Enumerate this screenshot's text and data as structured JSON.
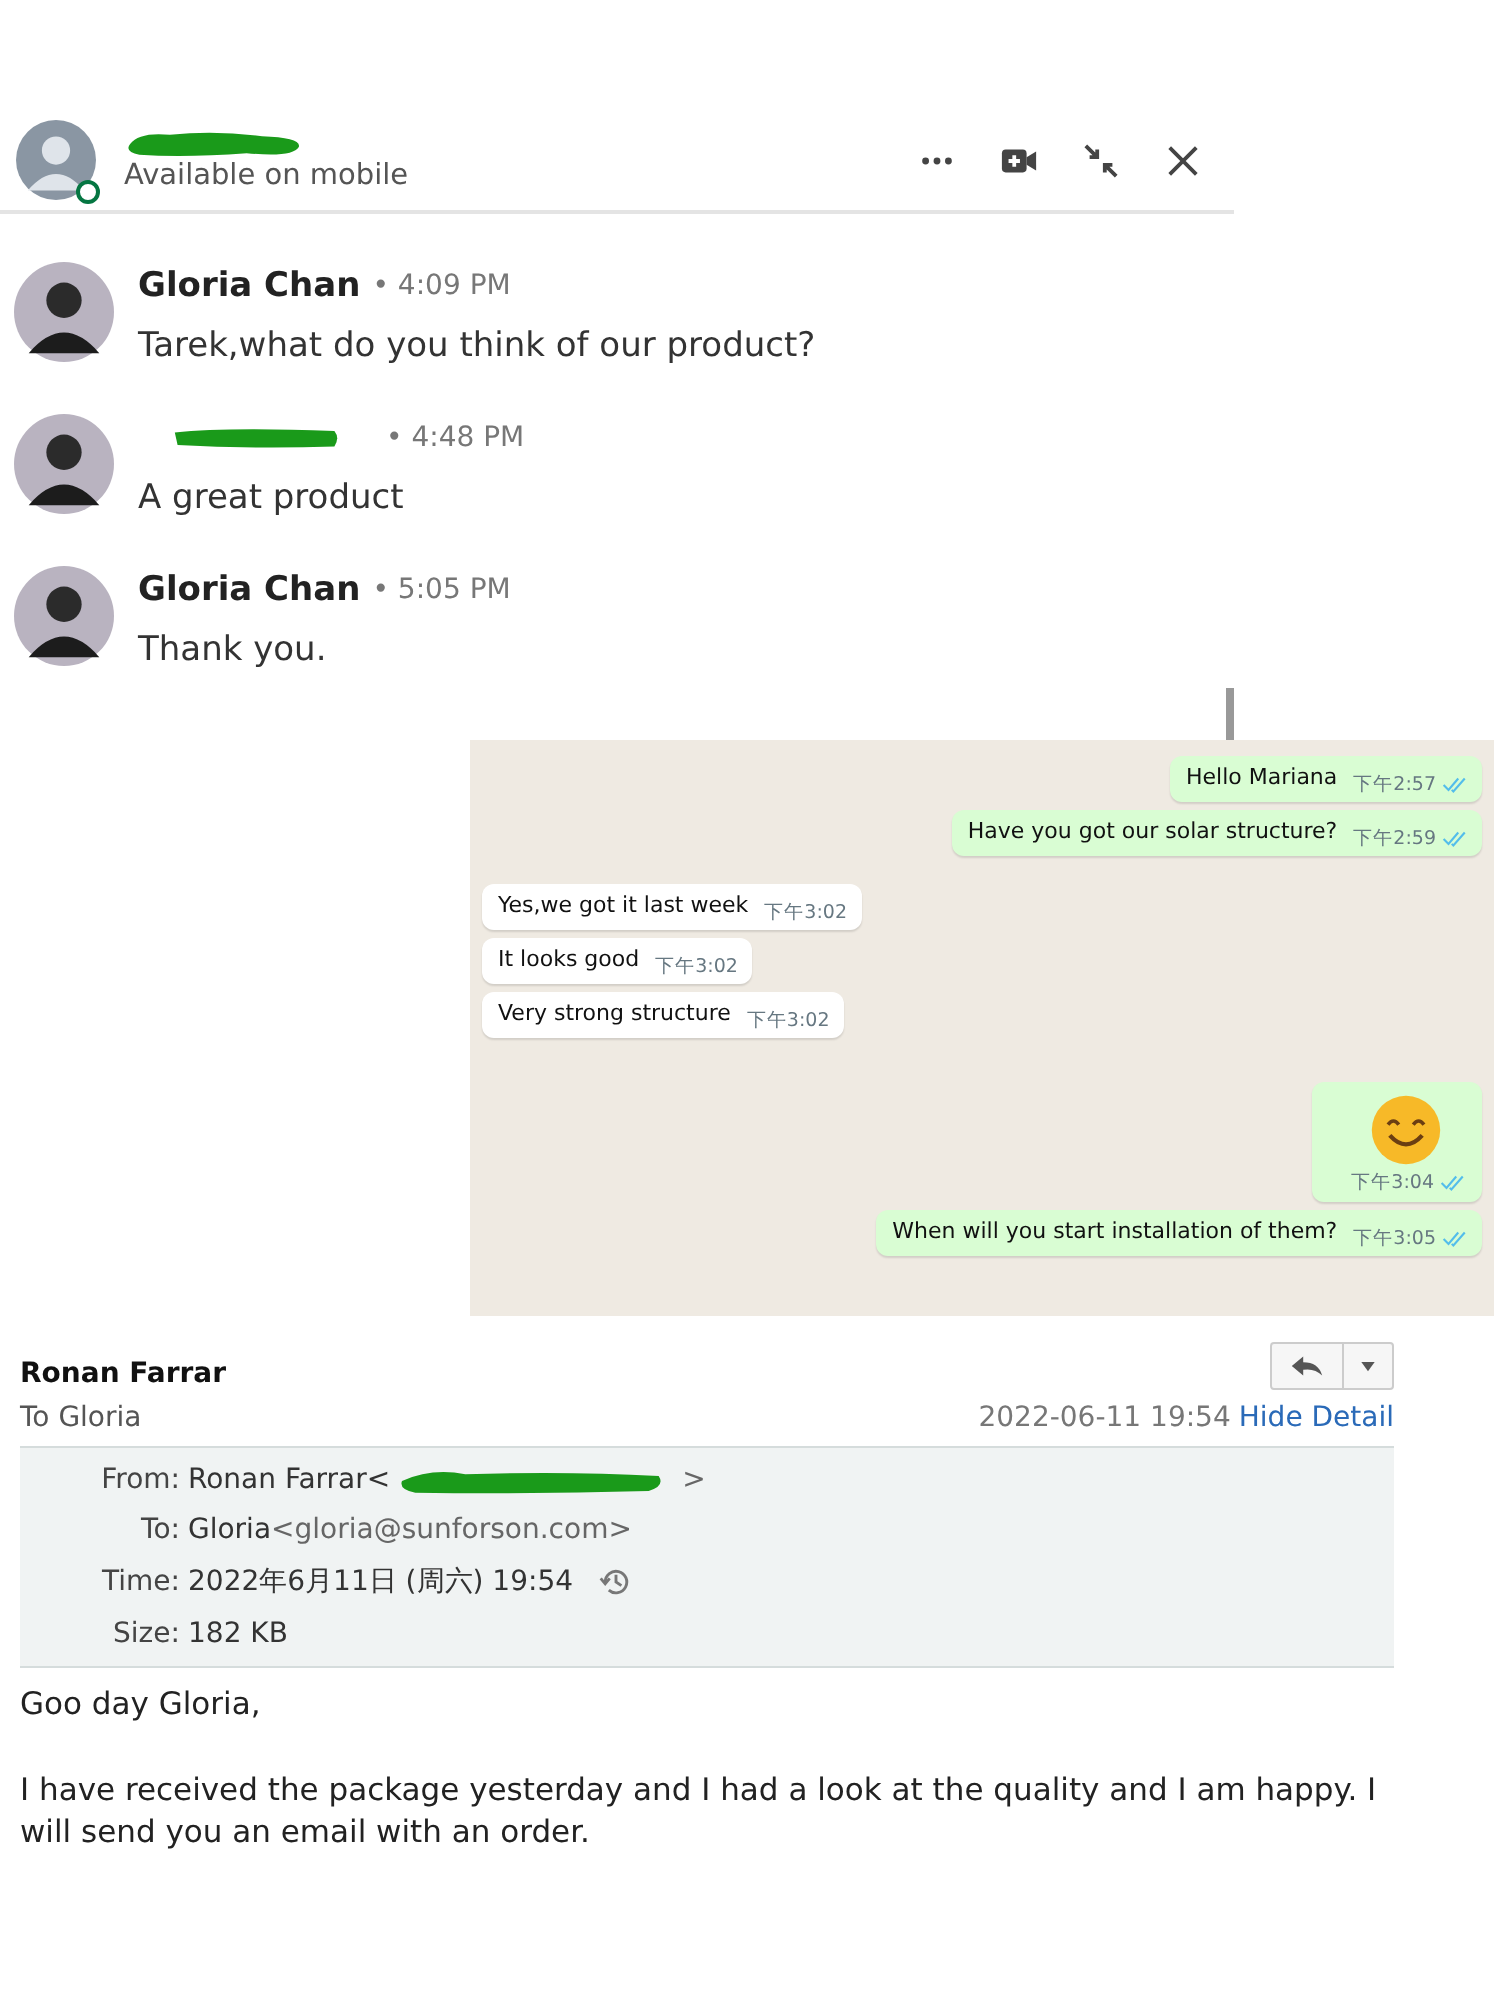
{
  "chat": {
    "header": {
      "status": "Available on mobile",
      "online": true
    },
    "messages": [
      {
        "sender": "Gloria Chan",
        "time": "• 4:09 PM",
        "text": "Tarek,what do you think of our product?",
        "redacted": false
      },
      {
        "time": "• 4:48 PM",
        "text": "A great product",
        "redacted": true
      },
      {
        "sender": "Gloria Chan",
        "time": "• 5:05 PM",
        "text": "Thank you.",
        "redacted": false
      }
    ]
  },
  "whatsapp": {
    "messages": [
      {
        "kind": "out",
        "text": "Hello Mariana",
        "time": "下午2:57",
        "read": true
      },
      {
        "kind": "out",
        "text": "Have you got our solar structure?",
        "time": "下午2:59",
        "read": true
      },
      {
        "kind": "in",
        "text": "Yes,we got it last week",
        "time": "下午3:02",
        "read": false
      },
      {
        "kind": "in",
        "text": "It looks good",
        "time": "下午3:02",
        "read": false
      },
      {
        "kind": "in",
        "text": "Very strong structure",
        "time": "下午3:02",
        "read": false
      },
      {
        "kind": "emoji",
        "time": "下午3:04",
        "read": true
      },
      {
        "kind": "out",
        "text": "When will you start installation of them?",
        "time": "下午3:05",
        "read": true
      }
    ]
  },
  "email": {
    "sender": "Ronan Farrar",
    "recipient": "To Gloria",
    "date": "2022-06-11 19:54",
    "detail_link": "Hide Detail",
    "details": [
      {
        "label": "From:",
        "value": "Ronan Farrar<",
        "redacted": true,
        "suffix": ">"
      },
      {
        "label": "To:",
        "value": "Gloria",
        "address": "<gloria@sunforson.com>"
      },
      {
        "label": "Time:",
        "value": "2022年6月11日 (周六) 19:54",
        "history": true
      },
      {
        "label": "Size:",
        "value": "182 KB"
      }
    ],
    "body": [
      "Goo day Gloria,",
      "I have received the package yesterday and I had a look at the quality and I am happy. I will send you an email with an order."
    ]
  }
}
